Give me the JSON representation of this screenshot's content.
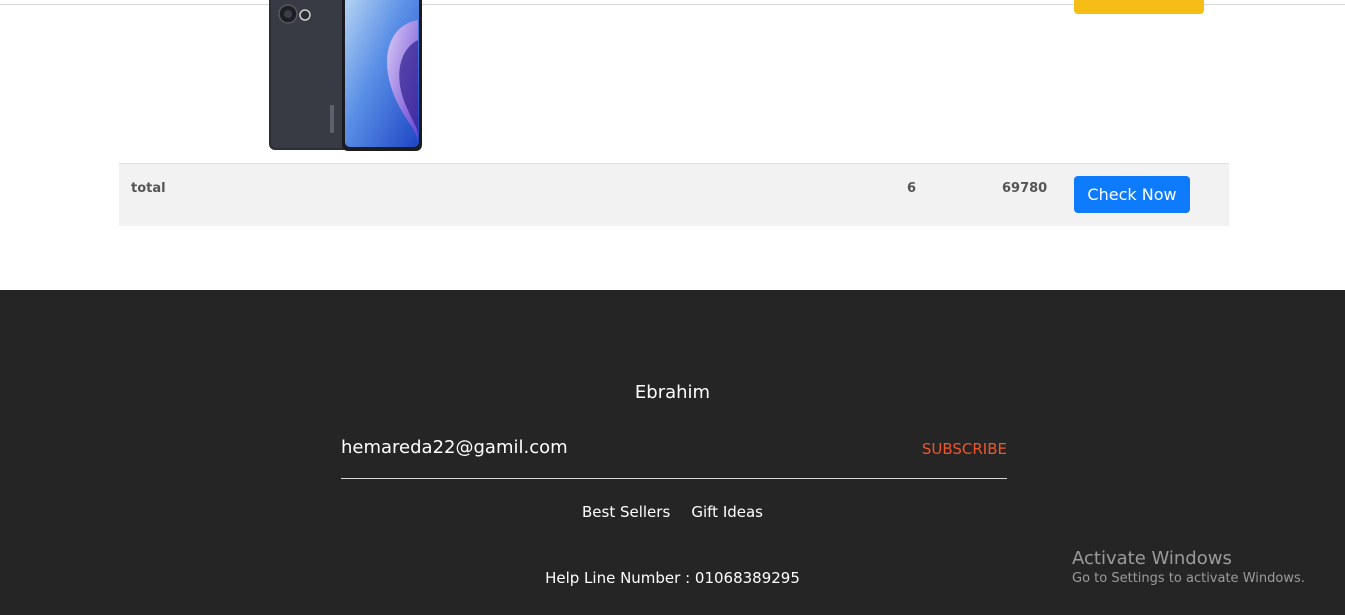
{
  "cart": {
    "total_label": "total",
    "total_quantity": "6",
    "total_price": "69780",
    "check_button_label": "Check Now"
  },
  "footer": {
    "brand": "Ebrahim",
    "email_value": "hemareda22@gamil.com",
    "subscribe_label": "SUBSCRIBE",
    "links": [
      "Best Sellers",
      "Gift Ideas"
    ],
    "helpline": "Help Line Number : 01068389295"
  },
  "overlay": {
    "activate_title": "Activate Windows",
    "activate_subtitle": "Go to Settings to activate Windows."
  },
  "colors": {
    "primary_button": "#0d7bfb",
    "accent_yellow": "#f5bd16",
    "subscribe": "#f0562a",
    "footer_bg": "#252525"
  },
  "icons": {
    "product_image": "oppo-phone-image"
  }
}
